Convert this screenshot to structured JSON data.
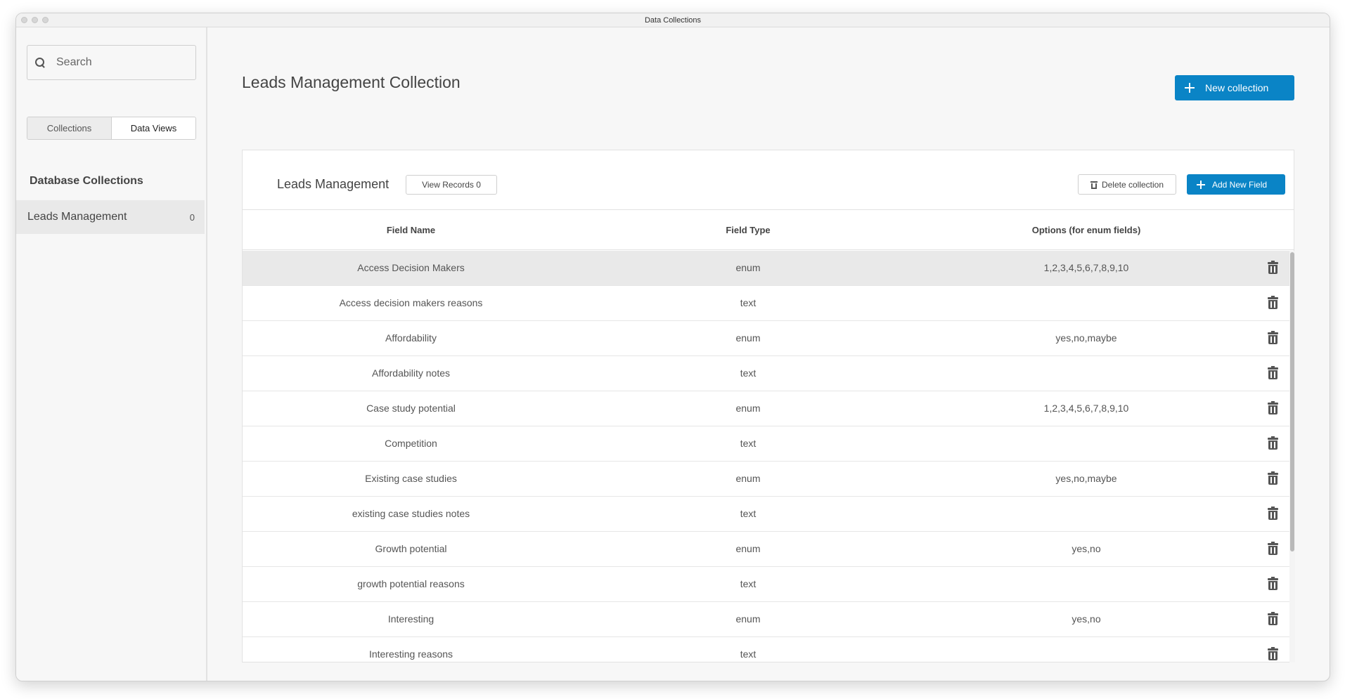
{
  "window": {
    "title": "Data Collections"
  },
  "sidebar": {
    "search": {
      "placeholder": "Search",
      "value": ""
    },
    "tabs": [
      {
        "label": "Collections",
        "active": false
      },
      {
        "label": "Data Views",
        "active": true
      }
    ],
    "heading": "Database Collections",
    "collections": [
      {
        "label": "Leads Management",
        "count": "0",
        "selected": true
      }
    ]
  },
  "main": {
    "title": "Leads Management Collection",
    "new_collection_label": "New collection",
    "card": {
      "title": "Leads Management",
      "view_records_label": "View Records 0",
      "delete_label": "Delete collection",
      "add_field_label": "Add New Field",
      "columns": [
        "Field Name",
        "Field Type",
        "Options (for enum fields)"
      ],
      "rows": [
        {
          "name": "Access Decision Makers",
          "type": "enum",
          "options": "1,2,3,4,5,6,7,8,9,10"
        },
        {
          "name": "Access decision makers reasons",
          "type": "text",
          "options": ""
        },
        {
          "name": "Affordability",
          "type": "enum",
          "options": "yes,no,maybe"
        },
        {
          "name": "Affordability notes",
          "type": "text",
          "options": ""
        },
        {
          "name": "Case study potential",
          "type": "enum",
          "options": "1,2,3,4,5,6,7,8,9,10"
        },
        {
          "name": "Competition",
          "type": "text",
          "options": ""
        },
        {
          "name": "Existing case studies",
          "type": "enum",
          "options": "yes,no,maybe"
        },
        {
          "name": "existing case studies notes",
          "type": "text",
          "options": ""
        },
        {
          "name": "Growth potential",
          "type": "enum",
          "options": "yes,no"
        },
        {
          "name": "growth potential reasons",
          "type": "text",
          "options": ""
        },
        {
          "name": "Interesting",
          "type": "enum",
          "options": "yes,no"
        },
        {
          "name": "Interesting reasons",
          "type": "text",
          "options": ""
        }
      ]
    }
  },
  "colors": {
    "accent": "#0a84c6",
    "selected_row": "#e9e9e9"
  }
}
